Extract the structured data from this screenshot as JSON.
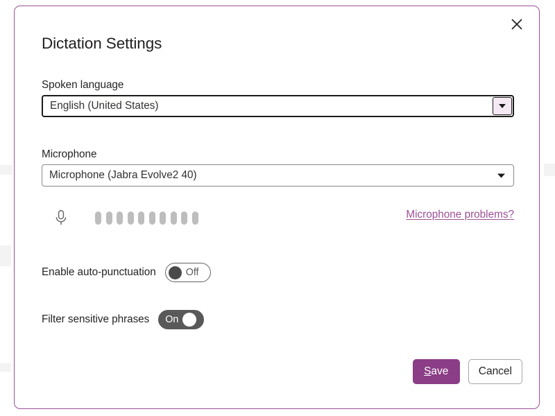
{
  "dialog": {
    "title": "Dictation Settings",
    "close_icon": "close-icon",
    "close_label": "Close"
  },
  "spoken_language": {
    "label": "Spoken language",
    "value": "English (United States)",
    "arrow_icon": "chevron-down-icon"
  },
  "microphone": {
    "label": "Microphone",
    "value": "Microphone (Jabra Evolve2 40)",
    "arrow_icon": "chevron-down-icon",
    "mic_icon": "microphone-icon",
    "level_bars": 10,
    "level_active": 0,
    "problems_link": "Microphone problems?"
  },
  "options": {
    "auto_punctuation": {
      "label": "Enable auto-punctuation",
      "state": "Off",
      "on": false
    },
    "filter_sensitive": {
      "label": "Filter sensitive phrases",
      "state": "On",
      "on": true
    }
  },
  "footer": {
    "save_accel": "S",
    "save_rest": "ave",
    "save_label": "Save",
    "cancel_label": "Cancel"
  },
  "colors": {
    "accent_purple": "#9b4f96",
    "save_purple": "#8b3d86",
    "link_purple": "#9b4f96",
    "toggle_on_bg": "#595959",
    "level_bar": "#bdbdbd",
    "dialog_border": "#9b4f96"
  }
}
